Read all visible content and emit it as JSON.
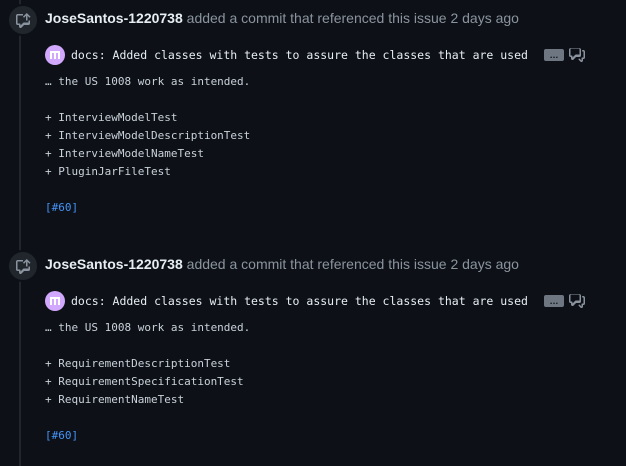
{
  "events": [
    {
      "author": "JoseSantos-1220738",
      "action": "added a commit that referenced this issue 2 days ago",
      "commit_message": "docs: Added classes with tests to assure the classes that are used in…",
      "continuation": "… the US 1008 work as intended.",
      "items": [
        "+ InterviewModelTest",
        "+ InterviewModelDescriptionTest",
        "+ InterviewModelNameTest",
        "+ PluginJarFileTest"
      ],
      "issue_ref": "[#60]"
    },
    {
      "author": "JoseSantos-1220738",
      "action": "added a commit that referenced this issue 2 days ago",
      "commit_message": "docs: Added classes with tests to assure the classes that are used in…",
      "continuation": "… the US 1008 work as intended.",
      "items": [
        "+ RequirementDescriptionTest",
        "+ RequirementSpecificationTest",
        "+ RequirementNameTest"
      ],
      "issue_ref": "[#60]"
    }
  ],
  "ui": {
    "ellipsis_label": "…",
    "icons": [
      "cross-reference-icon",
      "avatar-icon",
      "comment-discussion-icon"
    ],
    "colors": {
      "background": "#0d1117",
      "muted": "#8b949e",
      "link": "#4493f8",
      "avatar": "#d2a8ff"
    }
  }
}
